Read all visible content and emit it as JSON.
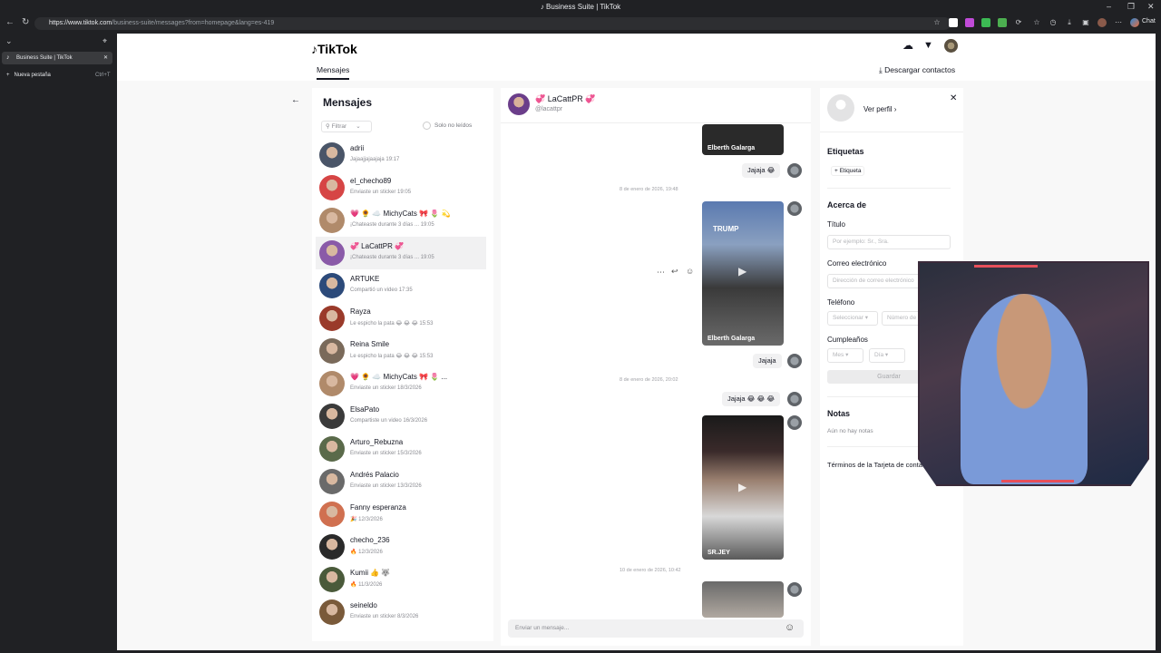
{
  "browser": {
    "window_title": "Business Suite | TikTok",
    "url_host": "https://www.tiktok.com",
    "url_path": "/business-suite/messages?from=homepage&lang=es-419",
    "chat_button": "Chat"
  },
  "sidebar": {
    "tab_label": "Business Suite | TikTok",
    "new_tab_label": "Nueva pestaña",
    "new_tab_shortcut": "Ctrl+T"
  },
  "header": {
    "logo": "TikTok",
    "tab_messages": "Mensajes",
    "download_contacts": "Descargar contactos"
  },
  "list": {
    "title": "Mensajes",
    "filter_label": "Filtrar",
    "unread_label": "Solo no leídos",
    "conversations": [
      {
        "name": "adrii",
        "preview": "Jajaajjajaajaja 19:17",
        "color": "#4a5568"
      },
      {
        "name": "el_checho89",
        "preview": "Enviaste un sticker 19:05",
        "color": "#d64545"
      },
      {
        "name": "💗 🌻 ☁️ MichyCats 🎀 🌷 💫",
        "preview": "¡Chateaste durante 3 días ... 19:05",
        "color": "#b08a6a"
      },
      {
        "name": "💞 LaCattPR 💞",
        "preview": "¡Chateaste durante 3 días ... 19:05",
        "color": "#8a5aa8"
      },
      {
        "name": "ARTUKE",
        "preview": "Compartió un video 17:35",
        "color": "#2c4a7a"
      },
      {
        "name": "Rayza",
        "preview": "Le espicho la pata 😂 😂 😂 15:53",
        "color": "#9a3a2a"
      },
      {
        "name": "Reina Smile",
        "preview": "Le espicho la pata 😂 😂 😂 15:53",
        "color": "#7a6a5a"
      },
      {
        "name": "💗 🌻 ☁️ MichyCats 🎀 🌷 ...",
        "preview": "Enviaste un sticker 18/3/2026",
        "color": "#b08a6a"
      },
      {
        "name": "ElsaPato",
        "preview": "Compartiste un video 16/3/2026",
        "color": "#3a3a3a"
      },
      {
        "name": "Arturo_Rebuzna",
        "preview": "Enviaste un sticker 15/3/2026",
        "color": "#5a6a4a"
      },
      {
        "name": "Andrés Palacio",
        "preview": "Enviaste un sticker 13/3/2026",
        "color": "#6a6a6a"
      },
      {
        "name": "Fanny esperanza",
        "preview": "🎉 12/3/2026",
        "color": "#d07050"
      },
      {
        "name": "checho_236",
        "preview": "🔥 12/3/2026",
        "color": "#2a2a2a"
      },
      {
        "name": "Kumii 👍 🐺",
        "preview": "🔥 11/3/2026",
        "color": "#4a5a3a"
      },
      {
        "name": "seineldo",
        "preview": "Enviaste un sticker 8/3/2026",
        "color": "#7a5a3a"
      }
    ]
  },
  "chat": {
    "name": "💞 LaCattPR 💞",
    "handle": "@lacattpr",
    "messages": {
      "b1": "Jajaja 😂",
      "b2": "Jajaja",
      "b3": "Jajaja 😂 😂 😂"
    },
    "timestamps": {
      "t1": "8 de enero de 2026, 19:48",
      "t2": "8 de enero de 2026, 20:02",
      "t3": "10 de enero de 2026, 10:42"
    },
    "videos": {
      "v0": "Elberth Galarga",
      "v1": "Elberth Galarga",
      "v2": "SR.JEY"
    },
    "composer_placeholder": "Enviar un mensaje..."
  },
  "profile": {
    "view_profile": "Ver perfil",
    "tags_title": "Etiquetas",
    "add_tag": "+ Etiqueta",
    "about_title": "Acerca de",
    "title_label": "Título",
    "title_placeholder": "Por ejemplo: Sr., Sra.",
    "email_label": "Correo electrónico",
    "email_placeholder": "Dirección de correo electrónico",
    "phone_label": "Teléfono",
    "phone_select": "Seleccionar",
    "phone_placeholder": "Número de teléfono",
    "birthday_label": "Cumpleaños",
    "month_placeholder": "Mes",
    "day_placeholder": "Día",
    "save_button": "Guardar",
    "notes_title": "Notas",
    "no_notes": "Aún no hay notas",
    "terms": "Términos de la Tarjeta de contacto"
  }
}
